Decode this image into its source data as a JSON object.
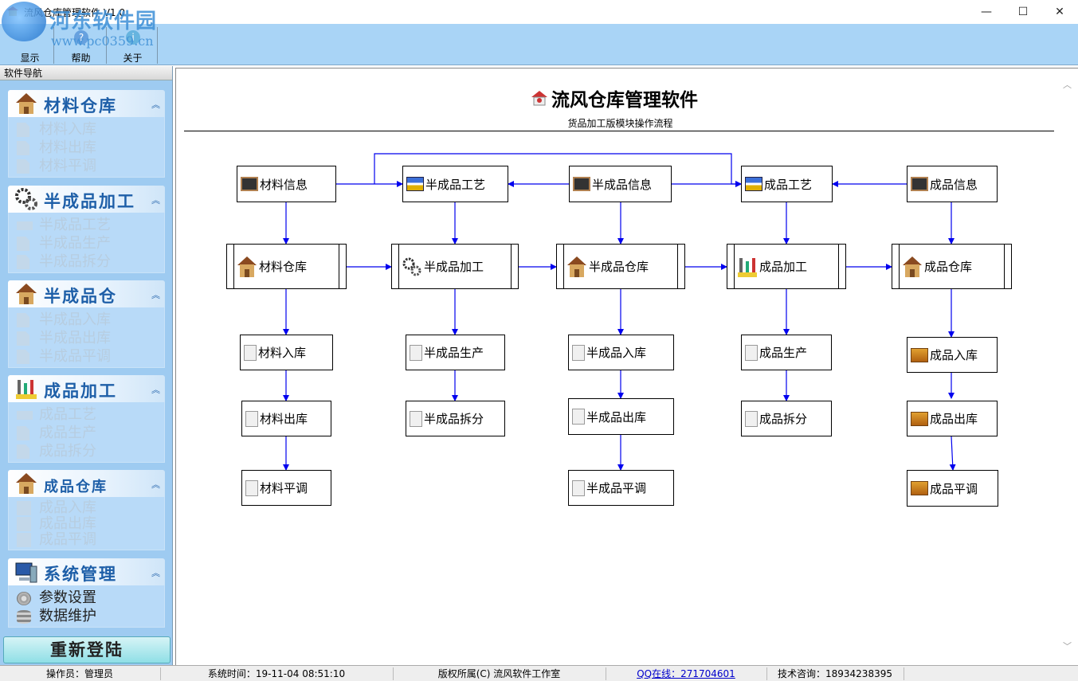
{
  "window": {
    "title": "流风仓库管理软件 V1.0",
    "minimize_glyph": "—",
    "maximize_glyph": "☐",
    "close_glyph": "✕"
  },
  "watermark": {
    "title": "河东软件园",
    "url": "www.pc0359.cn"
  },
  "toolbar": {
    "items": [
      {
        "label": "显示"
      },
      {
        "label": "帮助"
      },
      {
        "label": "关于"
      }
    ]
  },
  "sidebar": {
    "header": "软件导航",
    "groups": [
      {
        "title": "材料仓库",
        "icon": "warehouse-icon",
        "items": [
          "材料入库",
          "材料出库",
          "材料平调"
        ]
      },
      {
        "title": "半成品加工",
        "icon": "gears-icon",
        "items": [
          "半成品工艺",
          "半成品生产",
          "半成品拆分"
        ]
      },
      {
        "title": "半成品仓",
        "icon": "warehouse-icon",
        "items": [
          "半成品入库",
          "半成品出库",
          "半成品平调"
        ]
      },
      {
        "title": "成品加工",
        "icon": "tools-icon",
        "items": [
          "成品工艺",
          "成品生产",
          "成品拆分"
        ]
      },
      {
        "title": "成品仓库",
        "icon": "warehouse-icon",
        "items": [
          "成品入库",
          "成品出库",
          "成品平调"
        ]
      },
      {
        "title": "系统管理",
        "icon": "computer-icon",
        "items": [
          "参数设置",
          "数据维护"
        ]
      }
    ],
    "collapse_glyph": "︽",
    "relogin": "重新登陆"
  },
  "main": {
    "title": "流风仓库管理软件",
    "subtitle": "货品加工版模块操作流程",
    "nodes": {
      "cl_info": "材料信息",
      "bcp_gy": "半成品工艺",
      "bcp_info": "半成品信息",
      "cp_gy": "成品工艺",
      "cp_info": "成品信息",
      "cl_ck": "材料仓库",
      "bcp_jg": "半成品加工",
      "bcp_ck": "半成品仓库",
      "cp_jg": "成品加工",
      "cp_ck": "成品仓库",
      "cl_rk": "材料入库",
      "bcp_sc": "半成品生产",
      "bcp_rk": "半成品入库",
      "cp_sc": "成品生产",
      "cp_rk": "成品入库",
      "cl_chk": "材料出库",
      "bcp_cf": "半成品拆分",
      "bcp_chk": "半成品出库",
      "cp_cf": "成品拆分",
      "cp_chk": "成品出库",
      "cl_pt": "材料平调",
      "bcp_pt": "半成品平调",
      "cp_pt": "成品平调"
    },
    "arrow_color": "#0000ee"
  },
  "statusbar": {
    "operator": "操作员：管理员",
    "time": "系统时间：19-11-04 08:51:10",
    "copyright": "版权所属(C) 流风软件工作室",
    "qq": "QQ在线：271704601",
    "support": "技术咨询：18934238395"
  }
}
